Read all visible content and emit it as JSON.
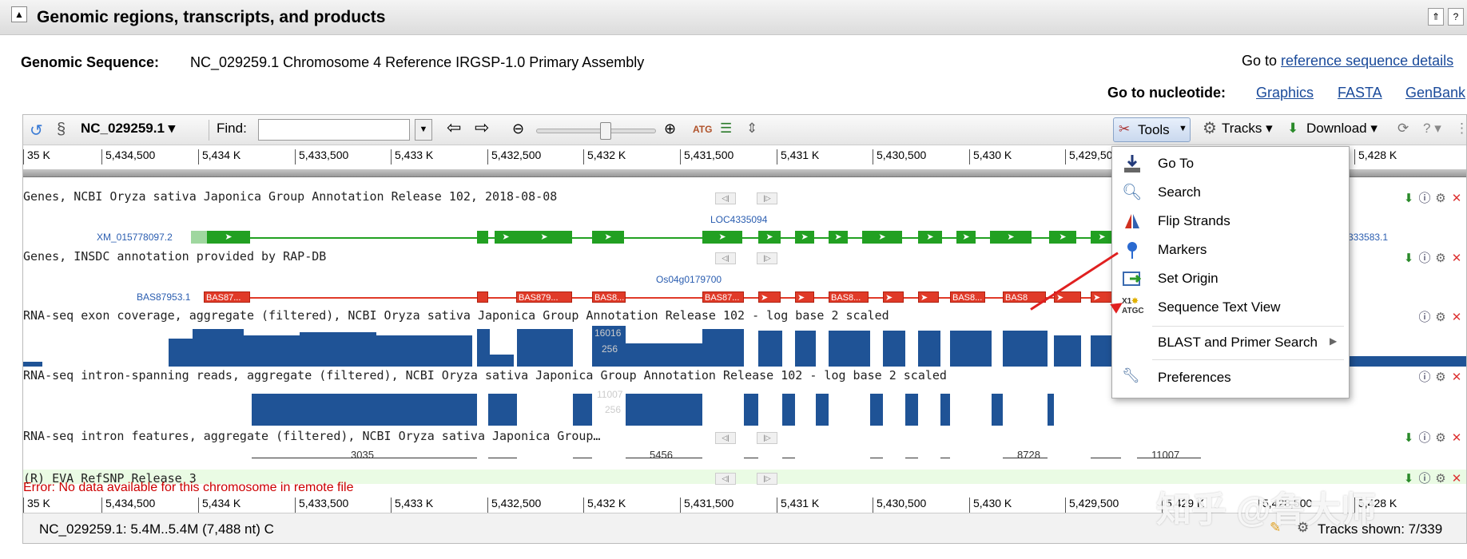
{
  "section": {
    "title": "Genomic regions, transcripts, and products",
    "collapse_icon": "▲",
    "ctrl_up": "⇑",
    "ctrl_help": "?"
  },
  "genomic": {
    "label": "Genomic Sequence:",
    "value": "NC_029259.1 Chromosome 4 Reference IRGSP-1.0 Primary Assembly",
    "goto_prefix": "Go to ",
    "goto_link": "reference sequence details",
    "nuc_label": "Go to nucleotide:",
    "nuc_links": [
      "Graphics",
      "FASTA",
      "GenBank"
    ]
  },
  "toolbar": {
    "seq_name": "NC_029259.1",
    "find_label": "Find:",
    "tools": "Tools",
    "tracks": "Tracks",
    "download": "Download",
    "help": "?"
  },
  "ruler": {
    "ticks": [
      "35 K",
      "5,434,500",
      "5,434 K",
      "5,433,500",
      "5,433 K",
      "5,432,500",
      "5,432 K",
      "5,431,500",
      "5,431 K",
      "5,430,500",
      "5,430 K",
      "5,429,500",
      "5,429 K",
      "5,428,500",
      "5,428 K"
    ]
  },
  "tracks": [
    {
      "title": "Genes, NCBI Oryza sativa Japonica Group Annotation Release 102, 2018-08-08",
      "left_label": "XM_015778097.2",
      "mid_label": "LOC4335094",
      "right_label": "333583.1"
    },
    {
      "title": "Genes, INSDC annotation provided by RAP-DB",
      "left_label": "BAS87953.1",
      "mid_label": "Os04g0179700",
      "exon_labels": [
        "BAS87...",
        "BAS879...",
        "BAS8...",
        "BAS87...",
        "BAS8...",
        "BAS8...",
        "BAS8"
      ]
    },
    {
      "title": "RNA-seq exon coverage, aggregate (filtered), NCBI Oryza sativa Japonica Group Annotation Release 102 - log base 2 scaled",
      "scale_labels": [
        "16016",
        "256"
      ]
    },
    {
      "title": "RNA-seq intron-spanning reads, aggregate (filtered), NCBI Oryza sativa Japonica Group Annotation Release 102 - log base 2 scaled",
      "scale_labels": [
        "11007",
        "256"
      ]
    },
    {
      "title": "RNA-seq intron features, aggregate (filtered), NCBI Oryza sativa Japonica Group…",
      "intron_labels": [
        "3035",
        "5456",
        "8728",
        "11007"
      ]
    },
    {
      "title": "(R) EVA RefSNP Release 3",
      "error": "Error: No data available for this chromosome in remote file"
    }
  ],
  "menu": {
    "items": [
      "Go To",
      "Search",
      "Flip Strands",
      "Markers",
      "Set Origin",
      "Sequence Text View",
      "BLAST and Primer Search",
      "Preferences"
    ]
  },
  "status": {
    "location": "NC_029259.1: 5.4M..5.4M (7,488 nt) C",
    "tracks_shown": "Tracks shown: 7/339"
  },
  "watermark": "知乎 @鲁大师",
  "colors": {
    "gene_green": "#22a022",
    "rap_red": "#e03a28",
    "coverage_blue": "#1f5396",
    "error_red": "#cc0000",
    "link_blue": "#1a4a9a"
  }
}
